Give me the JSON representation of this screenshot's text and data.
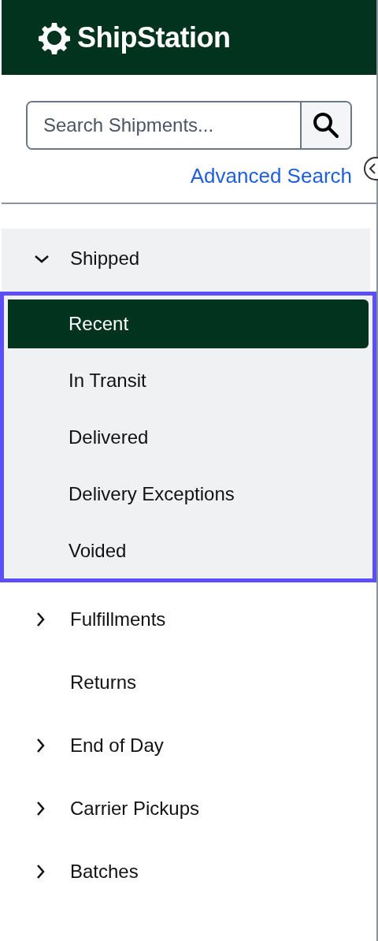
{
  "header": {
    "logo_text": "ShipStation"
  },
  "search": {
    "placeholder": "Search Shipments...",
    "advanced_link": "Advanced Search"
  },
  "nav": [
    {
      "kind": "group",
      "label": "Shipped",
      "expanded": true,
      "highlighted": true,
      "children": [
        {
          "label": "Recent",
          "selected": true
        },
        {
          "label": "In Transit",
          "selected": false
        },
        {
          "label": "Delivered",
          "selected": false
        },
        {
          "label": "Delivery Exceptions",
          "selected": false
        },
        {
          "label": "Voided",
          "selected": false
        }
      ]
    },
    {
      "kind": "group",
      "label": "Fulfillments",
      "expanded": false
    },
    {
      "kind": "link",
      "label": "Returns"
    },
    {
      "kind": "group",
      "label": "End of Day",
      "expanded": false
    },
    {
      "kind": "group",
      "label": "Carrier Pickups",
      "expanded": false
    },
    {
      "kind": "group",
      "label": "Batches",
      "expanded": false
    }
  ]
}
